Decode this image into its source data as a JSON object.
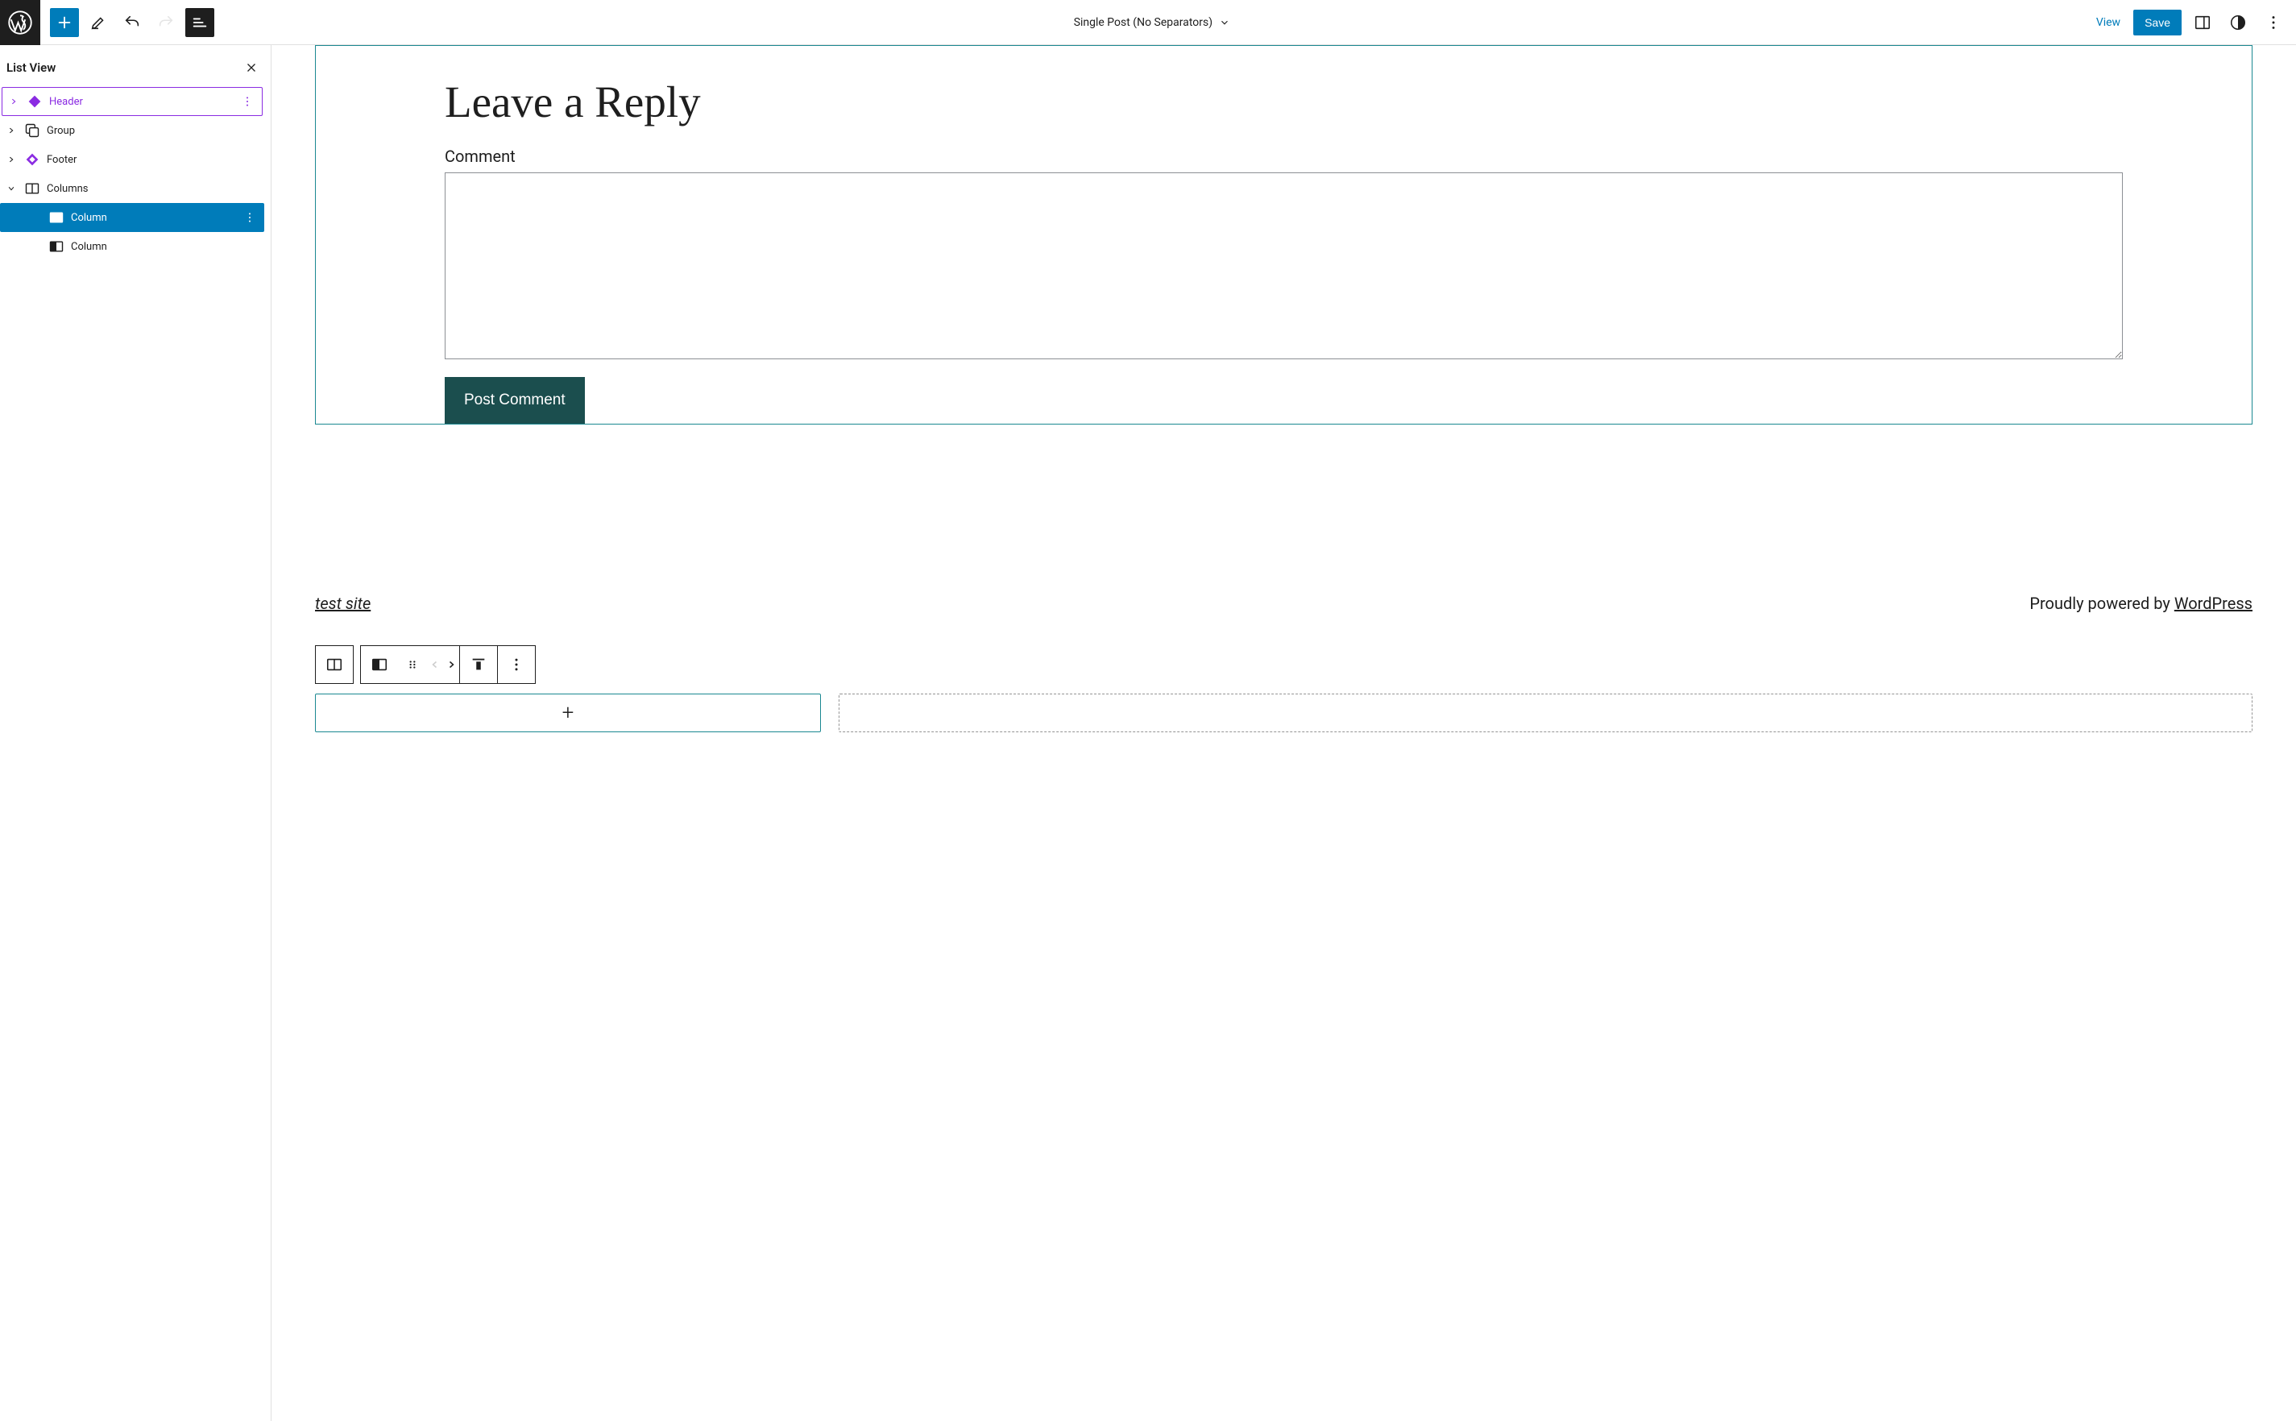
{
  "topbar": {
    "document_title": "Single Post (No Separators)",
    "view": "View",
    "save": "Save"
  },
  "sidebar": {
    "title": "List View",
    "items": [
      {
        "label": "Header",
        "type": "template-part",
        "selected": "outline",
        "expandable": true,
        "expanded": false
      },
      {
        "label": "Group",
        "type": "group",
        "expandable": true,
        "expanded": false
      },
      {
        "label": "Footer",
        "type": "template-part",
        "expandable": true,
        "expanded": false
      },
      {
        "label": "Columns",
        "type": "columns",
        "expandable": true,
        "expanded": true
      },
      {
        "label": "Column",
        "type": "column",
        "nested": true,
        "selected": "blue"
      },
      {
        "label": "Column",
        "type": "column",
        "nested": true
      }
    ]
  },
  "content": {
    "reply_title": "Leave a Reply",
    "comment_label": "Comment",
    "post_button": "Post Comment",
    "footer_site": "test site",
    "footer_powered": "Proudly powered by ",
    "footer_wp": "WordPress"
  }
}
